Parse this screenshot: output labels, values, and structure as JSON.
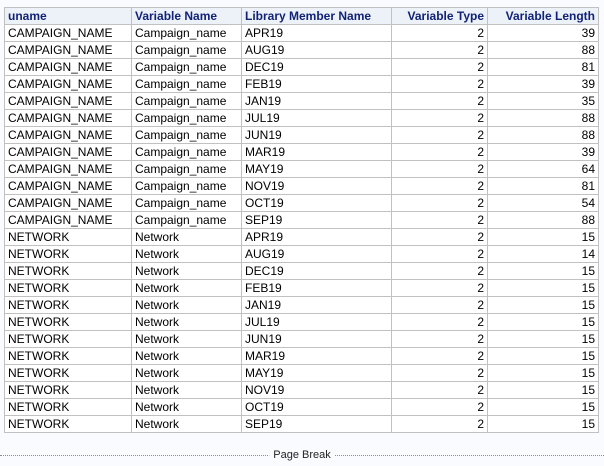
{
  "table": {
    "columns": [
      "uname",
      "Variable Name",
      "Library Member Name",
      "Variable Type",
      "Variable Length"
    ],
    "rows": [
      [
        "CAMPAIGN_NAME",
        "Campaign_name",
        "APR19",
        "2",
        "39"
      ],
      [
        "CAMPAIGN_NAME",
        "Campaign_name",
        "AUG19",
        "2",
        "88"
      ],
      [
        "CAMPAIGN_NAME",
        "Campaign_name",
        "DEC19",
        "2",
        "81"
      ],
      [
        "CAMPAIGN_NAME",
        "Campaign_name",
        "FEB19",
        "2",
        "39"
      ],
      [
        "CAMPAIGN_NAME",
        "Campaign_name",
        "JAN19",
        "2",
        "35"
      ],
      [
        "CAMPAIGN_NAME",
        "Campaign_name",
        "JUL19",
        "2",
        "88"
      ],
      [
        "CAMPAIGN_NAME",
        "Campaign_name",
        "JUN19",
        "2",
        "88"
      ],
      [
        "CAMPAIGN_NAME",
        "Campaign_name",
        "MAR19",
        "2",
        "39"
      ],
      [
        "CAMPAIGN_NAME",
        "Campaign_name",
        "MAY19",
        "2",
        "64"
      ],
      [
        "CAMPAIGN_NAME",
        "Campaign_name",
        "NOV19",
        "2",
        "81"
      ],
      [
        "CAMPAIGN_NAME",
        "Campaign_name",
        "OCT19",
        "2",
        "54"
      ],
      [
        "CAMPAIGN_NAME",
        "Campaign_name",
        "SEP19",
        "2",
        "88"
      ],
      [
        "NETWORK",
        "Network",
        "APR19",
        "2",
        "15"
      ],
      [
        "NETWORK",
        "Network",
        "AUG19",
        "2",
        "14"
      ],
      [
        "NETWORK",
        "Network",
        "DEC19",
        "2",
        "15"
      ],
      [
        "NETWORK",
        "Network",
        "FEB19",
        "2",
        "15"
      ],
      [
        "NETWORK",
        "Network",
        "JAN19",
        "2",
        "15"
      ],
      [
        "NETWORK",
        "Network",
        "JUL19",
        "2",
        "15"
      ],
      [
        "NETWORK",
        "Network",
        "JUN19",
        "2",
        "15"
      ],
      [
        "NETWORK",
        "Network",
        "MAR19",
        "2",
        "15"
      ],
      [
        "NETWORK",
        "Network",
        "MAY19",
        "2",
        "15"
      ],
      [
        "NETWORK",
        "Network",
        "NOV19",
        "2",
        "15"
      ],
      [
        "NETWORK",
        "Network",
        "OCT19",
        "2",
        "15"
      ],
      [
        "NETWORK",
        "Network",
        "SEP19",
        "2",
        "15"
      ]
    ]
  },
  "page_break": {
    "label": "Page Break"
  },
  "colors": {
    "header_text": "#112277",
    "header_bg": "#edf2f9",
    "grid": "#c1c1c1",
    "page_bg": "#fafbfe"
  }
}
